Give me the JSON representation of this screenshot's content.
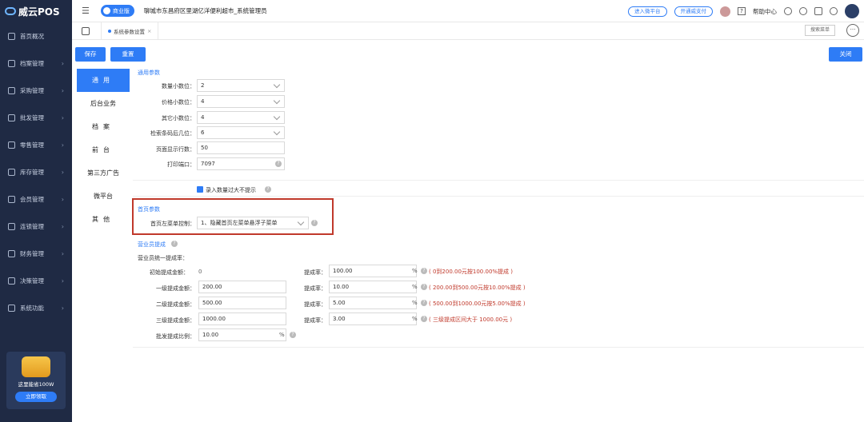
{
  "sidebar": {
    "logo": "威云POS",
    "items": [
      {
        "label": "首页概况",
        "icon": "home-icon"
      },
      {
        "label": "档案管理",
        "icon": "folder-icon"
      },
      {
        "label": "采购管理",
        "icon": "cart-icon"
      },
      {
        "label": "批发管理",
        "icon": "box-icon"
      },
      {
        "label": "零售管理",
        "icon": "shop-icon"
      },
      {
        "label": "库存管理",
        "icon": "warehouse-icon"
      },
      {
        "label": "会员管理",
        "icon": "member-icon"
      },
      {
        "label": "连锁管理",
        "icon": "chain-icon"
      },
      {
        "label": "财务管理",
        "icon": "finance-icon"
      },
      {
        "label": "决策管理",
        "icon": "chart-icon"
      },
      {
        "label": "系统功能",
        "icon": "gear-icon"
      }
    ],
    "promo": {
      "text": "这里能省100W",
      "button": "立即领取"
    }
  },
  "topbar": {
    "edition": "商业版",
    "store": "聊城市东昌府区里湖亿洋便利超市_系统管理员",
    "enter_pay": "进入微平台",
    "open_pay": "开通威支付",
    "help": "帮助中心",
    "q": "?"
  },
  "tabs": {
    "current": "系统参数设置",
    "close": "×",
    "search_menu": "搜索菜单",
    "more": "···"
  },
  "toolbar": {
    "save": "保存",
    "reset": "重置",
    "close": "关闭"
  },
  "left_tabs": [
    "通用",
    "后台业务",
    "档案",
    "前台",
    "第三方广告",
    "微平台",
    "其他"
  ],
  "general": {
    "title": "通用参数",
    "fields": [
      {
        "label": "数量小数位：",
        "value": "2",
        "select": true
      },
      {
        "label": "价格小数位：",
        "value": "4",
        "select": true
      },
      {
        "label": "其它小数位：",
        "value": "4",
        "select": true
      },
      {
        "label": "检索条码后几位：",
        "value": "6",
        "select": true
      },
      {
        "label": "页面显示行数：",
        "value": "50",
        "select": false
      },
      {
        "label": "打印端口：",
        "value": "7097",
        "select": false
      }
    ],
    "checkbox": "录入数量过大不提示"
  },
  "home": {
    "title": "首页参数",
    "label": "首页左菜单控制：",
    "value": "1、隐藏首页左菜单悬浮子菜单"
  },
  "commission": {
    "title": "营业员提成",
    "subtitle": "营业员统一提成率：",
    "rows": [
      {
        "label": "初始提成金额：",
        "amount": "0",
        "rate_label": "提成率：",
        "rate": "100.00",
        "note": "( 0到200.00元按100.00%提成 )"
      },
      {
        "label": "一级提成金额：",
        "amount": "200.00",
        "rate_label": "提成率：",
        "rate": "10.00",
        "note": "( 200.00到500.00元按10.00%提成 )"
      },
      {
        "label": "二级提成金额：",
        "amount": "500.00",
        "rate_label": "提成率：",
        "rate": "5.00",
        "note": "( 500.00到1000.00元按5.00%提成 )"
      },
      {
        "label": "三级提成金额：",
        "amount": "1000.00",
        "rate_label": "提成率：",
        "rate": "3.00",
        "note": "( 三级提成区间大于 1000.00元 )"
      }
    ],
    "wholesale_label": "批发提成比例：",
    "wholesale_value": "10.00",
    "pct": "%"
  }
}
